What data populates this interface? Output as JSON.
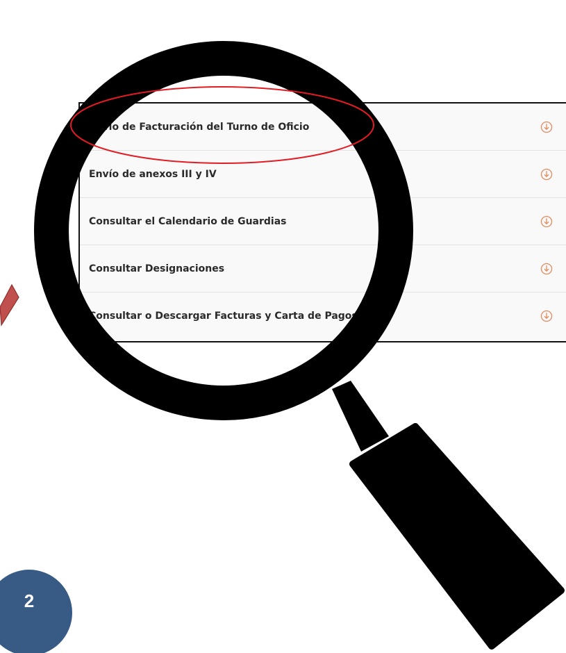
{
  "menu": {
    "items": [
      {
        "label": "Envío de Facturación del Turno de Oficio",
        "icon": "download-circle-icon",
        "highlighted": true
      },
      {
        "label": "Envío de anexos III y IV",
        "icon": "download-circle-icon",
        "highlighted": false
      },
      {
        "label": "Consultar el Calendario de Guardias",
        "icon": "download-circle-icon",
        "highlighted": false
      },
      {
        "label": "Consultar Designaciones",
        "icon": "download-circle-icon",
        "highlighted": false
      },
      {
        "label": "Consultar o Descargar Facturas y Carta de Pagos",
        "icon": "download-circle-icon",
        "highlighted": false
      }
    ]
  },
  "step_badge": {
    "number": "2"
  },
  "colors": {
    "accent_icon": "#e38a5c",
    "highlight_ellipse": "#e31b23",
    "badge": "#385b86",
    "magnifier": "#000000",
    "arrow_hint": "#c0504d"
  }
}
